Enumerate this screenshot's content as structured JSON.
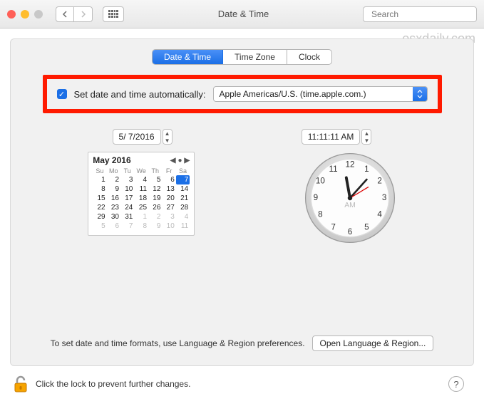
{
  "watermark": "osxdaily.com",
  "window": {
    "title": "Date & Time",
    "search_placeholder": "Search"
  },
  "tabs": {
    "date_time": "Date & Time",
    "time_zone": "Time Zone",
    "clock": "Clock"
  },
  "auto": {
    "label": "Set date and time automatically:",
    "server": "Apple Americas/U.S. (time.apple.com.)"
  },
  "date_field": "5/  7/2016",
  "time_field": "11:11:11 AM",
  "calendar": {
    "title": "May 2016",
    "dow": [
      "Su",
      "Mo",
      "Tu",
      "We",
      "Th",
      "Fr",
      "Sa"
    ],
    "rows": [
      [
        {
          "n": "1"
        },
        {
          "n": "2"
        },
        {
          "n": "3"
        },
        {
          "n": "4"
        },
        {
          "n": "5"
        },
        {
          "n": "6"
        },
        {
          "n": "7",
          "sel": true
        }
      ],
      [
        {
          "n": "8"
        },
        {
          "n": "9"
        },
        {
          "n": "10"
        },
        {
          "n": "11"
        },
        {
          "n": "12"
        },
        {
          "n": "13"
        },
        {
          "n": "14"
        }
      ],
      [
        {
          "n": "15"
        },
        {
          "n": "16"
        },
        {
          "n": "17"
        },
        {
          "n": "18"
        },
        {
          "n": "19"
        },
        {
          "n": "20"
        },
        {
          "n": "21"
        }
      ],
      [
        {
          "n": "22"
        },
        {
          "n": "23"
        },
        {
          "n": "24"
        },
        {
          "n": "25"
        },
        {
          "n": "26"
        },
        {
          "n": "27"
        },
        {
          "n": "28"
        }
      ],
      [
        {
          "n": "29"
        },
        {
          "n": "30"
        },
        {
          "n": "31"
        },
        {
          "n": "1",
          "dim": true
        },
        {
          "n": "2",
          "dim": true
        },
        {
          "n": "3",
          "dim": true
        },
        {
          "n": "4",
          "dim": true
        }
      ],
      [
        {
          "n": "5",
          "dim": true
        },
        {
          "n": "6",
          "dim": true
        },
        {
          "n": "7",
          "dim": true
        },
        {
          "n": "8",
          "dim": true
        },
        {
          "n": "9",
          "dim": true
        },
        {
          "n": "10",
          "dim": true
        },
        {
          "n": "11",
          "dim": true
        }
      ]
    ]
  },
  "clock": {
    "ampm": "AM"
  },
  "footer": {
    "text": "To set date and time formats, use Language & Region preferences.",
    "button": "Open Language & Region..."
  },
  "lock": {
    "text": "Click the lock to prevent further changes."
  }
}
